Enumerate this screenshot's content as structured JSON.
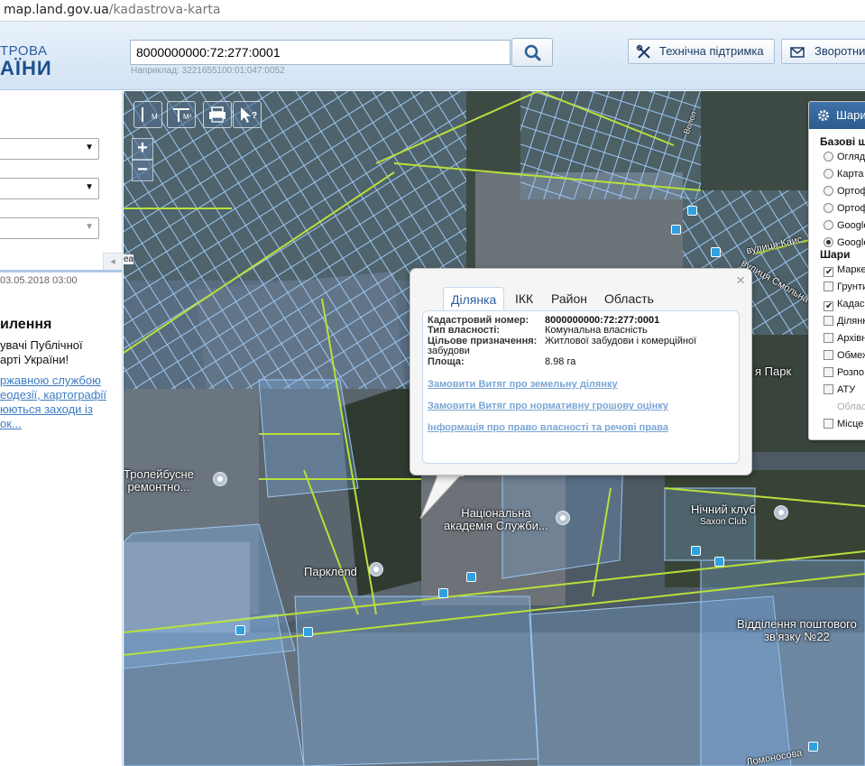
{
  "browser": {
    "host": "map.land.gov.ua",
    "path": "/kadastrova-karta"
  },
  "header": {
    "logo_line1": "ТРОВА",
    "logo_line2": "АЇНИ",
    "search_value": "8000000000:72:277:0001",
    "search_hint": "Наприклад: 3221655100:01:047:0052",
    "support_label": "Технічна підтримка",
    "feedback_label": "Зворотни"
  },
  "left_panel": {
    "date": "03.05.2018 03:00",
    "news_title": "илення",
    "news_text": [
      "увачі Публічної",
      "арті України!"
    ],
    "news_link": [
      "ржавною службою",
      "еодезії, картографії",
      "юються заходи із",
      "ок..."
    ],
    "collapse_glyph": "◂"
  },
  "map": {
    "toolbar": {
      "measure_line": "М",
      "measure_area": "М²",
      "print": "print",
      "info": "?"
    },
    "zoom_in": "+",
    "zoom_out": "−",
    "pois": {
      "trolley": [
        "Тролейбусне",
        "ремонтно..."
      ],
      "academy": [
        "Національна",
        "академія Служби..."
      ],
      "parkland": "Парклend",
      "nightclub": [
        "Нічний клуб",
        "Saxon Club"
      ],
      "park": "я Парк",
      "postoffice": [
        "Відділення поштового",
        "зв'язку №22"
      ]
    },
    "streets": {
      "kaisarova": "вулиця Каис",
      "smolna": "вулиця Смольна",
      "vodop": "Волоп",
      "lomonosova": "Ломоносова",
      "ea": "еа"
    }
  },
  "popup": {
    "tabs": [
      "Ділянка",
      "ІКК",
      "Район",
      "Область"
    ],
    "active_tab": "Ділянка",
    "close": "×",
    "fields": [
      {
        "label": "Кадастровий номер:",
        "value": "8000000000:72:277:0001"
      },
      {
        "label": "Тип власності:",
        "value": "Комунальна власність"
      },
      {
        "label": "Цільове призначення:",
        "value": "Житлової забудови і комерційної"
      },
      {
        "label": "",
        "value": "забудови"
      },
      {
        "label": "Площа:",
        "value": "8.98 га"
      }
    ],
    "links": [
      "Замовити Витяг про земельну ділянку",
      "Замовити Витяг про нормативну грошову оцінку",
      "Інформація про право власності та речові права"
    ]
  },
  "layers": {
    "title": "Шари",
    "base_header": "Базові ш",
    "base": [
      {
        "label": "Оглядо",
        "selected": false
      },
      {
        "label": "Карта",
        "selected": false
      },
      {
        "label": "Ортоф",
        "selected": false
      },
      {
        "label": "Ортоф",
        "selected": false
      },
      {
        "label": "Google",
        "selected": false
      },
      {
        "label": "Google",
        "selected": true
      }
    ],
    "overlay_header": "Шари",
    "overlays": [
      {
        "label": "Марке",
        "checked": true,
        "enabled": true
      },
      {
        "label": "Грунти",
        "checked": false,
        "enabled": true
      },
      {
        "label": "Кадас",
        "checked": true,
        "enabled": true
      },
      {
        "label": "Ділянк",
        "checked": false,
        "enabled": true
      },
      {
        "label": "Архівн",
        "checked": false,
        "enabled": true
      },
      {
        "label": "Обмеж",
        "checked": false,
        "enabled": true
      },
      {
        "label": "Розпо",
        "checked": false,
        "enabled": true
      },
      {
        "label": "АТУ",
        "checked": false,
        "enabled": true
      },
      {
        "label": "Облас",
        "checked": false,
        "enabled": false
      },
      {
        "label": "Місце",
        "checked": false,
        "enabled": true
      }
    ]
  },
  "colors": {
    "header_bg": "#d2e3f4",
    "brand_blue": "#1e4f8c",
    "parcel_fill": "#7fb3ea",
    "road_line": "#b8e03a",
    "link": "#3c7cc4"
  }
}
